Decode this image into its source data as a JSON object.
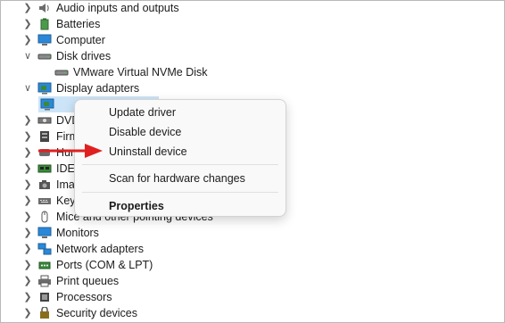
{
  "tree": [
    {
      "label": "Audio inputs and outputs",
      "icon": "speaker-icon",
      "expanded": false
    },
    {
      "label": "Batteries",
      "icon": "battery-icon",
      "expanded": false
    },
    {
      "label": "Computer",
      "icon": "computer-icon",
      "expanded": false
    },
    {
      "label": "Disk drives",
      "icon": "disk-drive-icon",
      "expanded": true
    },
    {
      "label": "VMware Virtual NVMe Disk",
      "icon": "disk-drive-icon",
      "child": true
    },
    {
      "label": "Display adapters",
      "icon": "display-adapter-icon",
      "expanded": true
    },
    {
      "label": "",
      "icon": "display-adapter-icon",
      "child": true,
      "selected": true
    },
    {
      "label": "DVD",
      "icon": "dvd-drive-icon",
      "expanded": false
    },
    {
      "label": "Firm",
      "icon": "firmware-icon",
      "expanded": false
    },
    {
      "label": "Hum",
      "icon": "hid-icon",
      "expanded": false
    },
    {
      "label": "IDE",
      "icon": "ide-controller-icon",
      "expanded": false
    },
    {
      "label": "Ima",
      "icon": "camera-icon",
      "expanded": false
    },
    {
      "label": "Key",
      "icon": "keyboard-icon",
      "expanded": false
    },
    {
      "label": "Mice and other pointing devices",
      "icon": "mouse-icon",
      "expanded": false
    },
    {
      "label": "Monitors",
      "icon": "monitor-icon",
      "expanded": false
    },
    {
      "label": "Network adapters",
      "icon": "network-icon",
      "expanded": false
    },
    {
      "label": "Ports (COM & LPT)",
      "icon": "port-icon",
      "expanded": false
    },
    {
      "label": "Print queues",
      "icon": "printer-icon",
      "expanded": false
    },
    {
      "label": "Processors",
      "icon": "processor-icon",
      "expanded": false
    },
    {
      "label": "Security devices",
      "icon": "security-icon",
      "expanded": false
    }
  ],
  "context_menu": {
    "update_driver": "Update driver",
    "disable_device": "Disable device",
    "uninstall_device": "Uninstall device",
    "scan_hardware": "Scan for hardware changes",
    "properties": "Properties"
  },
  "colors": {
    "selection": "#cce4f7",
    "arrow": "#e02020",
    "icon_blue": "#2b88d8",
    "icon_green": "#3a8a3a"
  }
}
